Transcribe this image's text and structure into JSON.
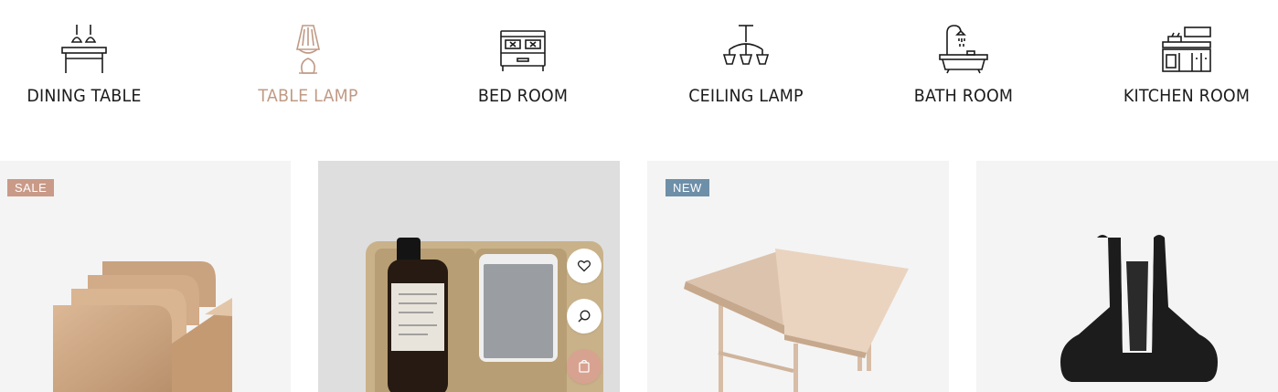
{
  "categories": [
    {
      "label": "DINING TABLE",
      "icon": "dining-table-icon",
      "active": false
    },
    {
      "label": "TABLE LAMP",
      "icon": "table-lamp-icon",
      "active": true
    },
    {
      "label": "BED ROOM",
      "icon": "bed-icon",
      "active": false
    },
    {
      "label": "CEILING LAMP",
      "icon": "ceiling-lamp-icon",
      "active": false
    },
    {
      "label": "BATH ROOM",
      "icon": "bathtub-icon",
      "active": false
    },
    {
      "label": "KITCHEN ROOM",
      "icon": "kitchen-icon",
      "active": false
    }
  ],
  "products": [
    {
      "badge": "SALE",
      "image": "wooden-card-holder"
    },
    {
      "badge": "",
      "image": "cork-tray-with-bottle-and-phone",
      "actions": [
        "heart-icon",
        "search-icon",
        "cart-icon"
      ]
    },
    {
      "badge": "NEW",
      "image": "wooden-book-stand"
    },
    {
      "badge": "",
      "image": "black-iron-card-holder"
    }
  ],
  "colors": {
    "accent": "#c09a85",
    "sale_badge": "#c99a88",
    "new_badge": "#6e8fa8",
    "cart_button": "#d8a290",
    "text": "#1b1b1b"
  }
}
